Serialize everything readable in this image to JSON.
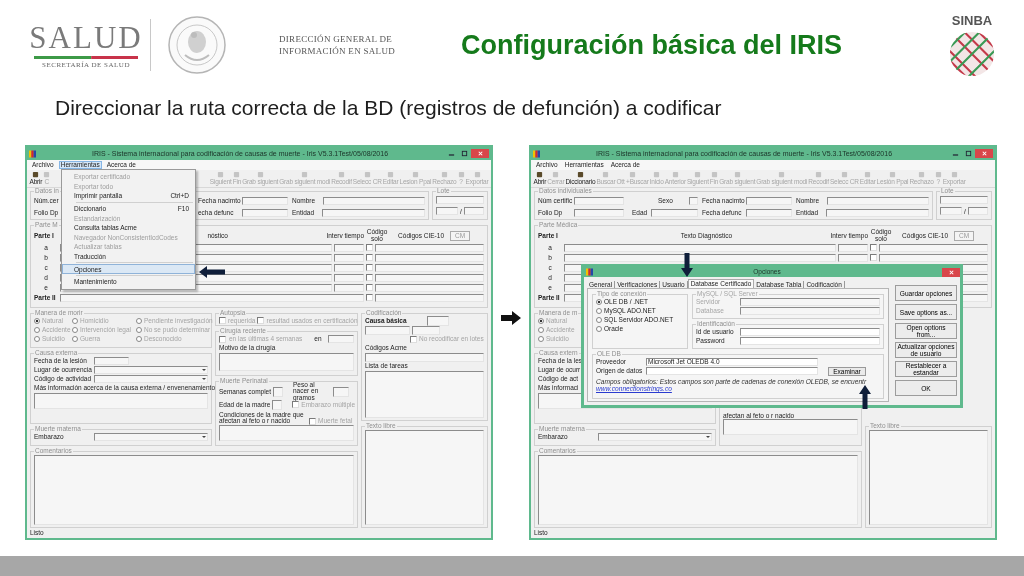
{
  "header": {
    "logo_name": "SALUD",
    "logo_sub": "SECRETARÍA DE SALUD",
    "dept": "DIRECCIÓN GENERAL DE INFORMACIÓN EN SALUD",
    "title": "Configuración básica del IRIS",
    "brand": "SINBA"
  },
  "subtitle": "Direccionar la ruta correcta de la BD (registros de defunción) a codificar",
  "windows": [
    {
      "title": "IRIS - Sistema internacional para codificación de causas de muerte - Iris V5.3.1Test/05/08/2016",
      "menu": [
        {
          "label": "Archivo",
          "selected": false
        },
        {
          "label": "Herramientas",
          "selected": true
        },
        {
          "label": "Acerca de",
          "selected": false
        }
      ],
      "toolbar": [
        {
          "label": "Abrir",
          "disabled": false
        },
        {
          "label": "C",
          "disabled": true
        },
        {
          "label": "Siguient",
          "disabled": true
        },
        {
          "label": "Fin",
          "disabled": true
        },
        {
          "label": "Grab siguient",
          "disabled": true
        },
        {
          "label": "Grab siguient modi",
          "disabled": true
        },
        {
          "label": "Recodif",
          "disabled": true
        },
        {
          "label": "Selecc CR",
          "disabled": true
        },
        {
          "label": "Editar",
          "disabled": true
        },
        {
          "label": "Lesion Ppal",
          "disabled": true
        },
        {
          "label": "Rechazo",
          "disabled": true
        },
        {
          "label": "?",
          "disabled": true
        },
        {
          "label": "Exportar",
          "disabled": true
        }
      ],
      "dropdown": [
        {
          "label": "Exportar certificado",
          "disabled": true,
          "selected": false
        },
        {
          "label": "Exportar todo",
          "disabled": true,
          "selected": false
        },
        {
          "label": "Imprimir pantalla",
          "shortcut": "Ctrl+D",
          "disabled": false,
          "selected": false
        },
        {
          "label": "Diccionario",
          "shortcut": "F10",
          "disabled": false,
          "selected": false,
          "separator_before": true
        },
        {
          "label": "Estandarización",
          "disabled": true,
          "selected": false
        },
        {
          "label": "Consulta tablas Acme",
          "disabled": false,
          "selected": false
        },
        {
          "label": "Navegador NonConsistentIcdCodes",
          "disabled": true,
          "selected": false
        },
        {
          "label": "Actualizar tablas",
          "disabled": true,
          "selected": false
        },
        {
          "label": "Traducción",
          "disabled": false,
          "selected": false
        },
        {
          "label": "Opciones",
          "disabled": false,
          "selected": true,
          "separator_before": true
        },
        {
          "label": "Mantenimiento",
          "disabled": false,
          "selected": false,
          "separator_before": true
        }
      ],
      "datos": {
        "title": "Datos in",
        "num": "Núm.cer",
        "nacim": "Fecha nacimto",
        "nombre": "Nombre",
        "folio": "Folio Dp",
        "defunc": "echa defunc",
        "entidad": "Entidad"
      },
      "lote": {
        "title": "Lote",
        "sep": "/"
      },
      "parte": {
        "title": "Parte M",
        "parte_i": "Parte I",
        "texto": "nóstico",
        "interv": "Interv tiempo",
        "codigo": "Código solo",
        "cie": "Códigos CIE-10",
        "cm": "CM",
        "rows": [
          {
            "label": "a",
            "code_only": false
          },
          {
            "label": "b",
            "code_only": false
          },
          {
            "label": "c",
            "code_only": false
          },
          {
            "label": "d",
            "code_only": false
          },
          {
            "label": "e",
            "code_only": false
          }
        ],
        "parte_ii": "Parte II",
        "parte_ii_code_only": false
      },
      "manera": {
        "title": "Manera de morir",
        "disabled": true,
        "options": [
          {
            "label": "Natural",
            "selected": true
          },
          {
            "label": "Accidente",
            "selected": false
          },
          {
            "label": "Suicidio",
            "selected": false
          },
          {
            "label": "Homicidio",
            "selected": false
          },
          {
            "label": "Intervención legal",
            "selected": false
          },
          {
            "label": "Guerra",
            "selected": false
          },
          {
            "label": "Pendiente investigación",
            "selected": false
          },
          {
            "label": "No se pudo determinar",
            "selected": false
          },
          {
            "label": "Desconocido",
            "selected": false
          }
        ]
      },
      "externa": {
        "title": "Causa externa",
        "fecha": "Fecha de la lesión",
        "lugar": "Lugar de ocurrencia",
        "codigo": "Código de actividad",
        "mas": "Más información acerca de la causa externa / envenenamiento"
      },
      "materna": {
        "title": "Muerte materna",
        "embarazo": "Embarazo"
      },
      "autopsia": {
        "title": "Autopsia",
        "options": [
          {
            "label": "requerida",
            "checked": false
          },
          {
            "label": "resultad usados en certificación",
            "checked": false
          }
        ]
      },
      "cirugia": {
        "title": "Cirugía reciente",
        "check": {
          "label": "en las últimas 4 semanas",
          "checked": false
        },
        "en": "en",
        "motivo": "Motivo de la cirugía"
      },
      "perinatal": {
        "title": "Muerte Perinatal",
        "semanas": "Semanas complet",
        "peso": "Peso al nacer en gramos",
        "edad": "Edad de la madre",
        "multiple": {
          "label": "Embarazo múltiple",
          "checked": false
        },
        "condiciones": "Condiciones de la madre que afectan al feto o r nacido",
        "fetal": {
          "label": "Muerte fetal",
          "checked": false
        }
      },
      "codif": {
        "title": "Codificación",
        "causa": "Causa básica",
        "norecod": {
          "label": "No recodificar en lotes",
          "checked": false
        },
        "acme": "Códigos Acme",
        "tareas": "Lista de tareas"
      },
      "texto_libre": "Texto libre",
      "comentarios": "Comentarios",
      "status": "Listo"
    },
    {
      "title": "IRIS - Sistema internacional para codificación de causas de muerte - Iris V5.3.1Test/05/08/2016",
      "menu": [
        {
          "label": "Archivo",
          "selected": false
        },
        {
          "label": "Herramientas",
          "selected": false
        },
        {
          "label": "Acerca de",
          "selected": false
        }
      ],
      "toolbar": [
        {
          "label": "Abrir",
          "disabled": false
        },
        {
          "label": "Cerrar",
          "disabled": true
        },
        {
          "label": "Diccionario",
          "disabled": false
        },
        {
          "label": "Buscar",
          "disabled": true
        },
        {
          "label": "Ott +Buscar",
          "disabled": true
        },
        {
          "label": "Inicio",
          "disabled": true
        },
        {
          "label": "Anterior",
          "disabled": true
        },
        {
          "label": "Siguient",
          "disabled": true
        },
        {
          "label": "Fin",
          "disabled": true
        },
        {
          "label": "Grab siguient",
          "disabled": true
        },
        {
          "label": "Grab siguient modi",
          "disabled": true
        },
        {
          "label": "Recodif",
          "disabled": true
        },
        {
          "label": "Selecc CR",
          "disabled": true
        },
        {
          "label": "Editar",
          "disabled": true
        },
        {
          "label": "Lesión Ppal",
          "disabled": true
        },
        {
          "label": "Rechazo",
          "disabled": true
        },
        {
          "label": "?",
          "disabled": true
        },
        {
          "label": "Exportar",
          "disabled": true
        }
      ],
      "datos": {
        "title": "Datos individuales",
        "num": "Núm certific",
        "sexo": "Sexo",
        "nacim": "Fecha nacimto",
        "nombre": "Nombre",
        "folio": "Folio Dp",
        "edad": "Edad",
        "defunc": "Fecha defunc",
        "entidad": "Entidad"
      },
      "lote": {
        "title": "Lote",
        "sep": "/"
      },
      "parte": {
        "title": "Parte Médica",
        "parte_i": "Parte I",
        "texto": "Texto Diagnóstico",
        "interv": "Interv tiempo",
        "codigo": "Código solo",
        "cie": "Códigos CIE-10",
        "cm": "CM",
        "rows": [
          {
            "label": "a",
            "code_only": false
          },
          {
            "label": "b",
            "code_only": false
          },
          {
            "label": "c"
          },
          {
            "label": "d"
          },
          {
            "label": "e"
          }
        ],
        "parte_ii": "Parte II"
      },
      "manera": {
        "title": "Manera de m",
        "disabled": true,
        "options": [
          {
            "label": "Natural",
            "selected": true
          },
          {
            "label": "Accidente",
            "selected": false
          },
          {
            "label": "Suicidio",
            "selected": false
          }
        ]
      },
      "externa": {
        "title": "Causa extern",
        "fecha": "Fecha de la les",
        "lugar": "Lugar de ocurr",
        "codigo": "Código de act",
        "mas": "Más informaci"
      },
      "materna": {
        "title": "Muerte materna",
        "embarazo": "Embarazo"
      },
      "perinatal": {
        "condiciones": "afectan al feto o r nacido"
      },
      "texto_libre": "Texto libre",
      "comentarios": "Comentarios",
      "status": "Listo",
      "dialog": {
        "title": "Opciones",
        "tabs": [
          {
            "label": "General",
            "selected": false
          },
          {
            "label": "Verificaciones",
            "selected": false
          },
          {
            "label": "Usuario",
            "selected": false
          },
          {
            "label": "Database Certificado",
            "selected": true
          },
          {
            "label": "Database Tabla",
            "selected": false
          },
          {
            "label": "Codificación",
            "selected": false
          }
        ],
        "conexion": {
          "title": "Tipo de conexión",
          "options": [
            {
              "label": "OLE DB / .NET",
              "selected": true
            },
            {
              "label": "MySQL ADO.NET",
              "selected": false
            },
            {
              "label": "SQL Servidor ADO.NET",
              "selected": false
            },
            {
              "label": "Oracle",
              "selected": false
            }
          ]
        },
        "mysql": {
          "title": "MySQL / SQL Server",
          "disabled": true,
          "servidor": "Servidor",
          "database": "Database"
        },
        "ident": {
          "title": "Identificación",
          "usuario": "Id de usuario",
          "password": "Password"
        },
        "oledb": {
          "title": "OLE DB",
          "proveedor": "Proveedor",
          "proveedor_value": "Microsoft Jet OLEDB 4.0",
          "origen": "Origen de datos",
          "examinar": "Examinar",
          "note": "Campos obligatorios: Estos campos son parte de cadenas de conexión OLEDB, se encuentr",
          "link": "www.connectionstrings.co"
        },
        "buttons": [
          "Guardar opciones",
          "Save options as...",
          "Open options from...",
          "Actualizar opciones de usuario",
          "Restablecer a estandar",
          "OK"
        ]
      }
    }
  ]
}
